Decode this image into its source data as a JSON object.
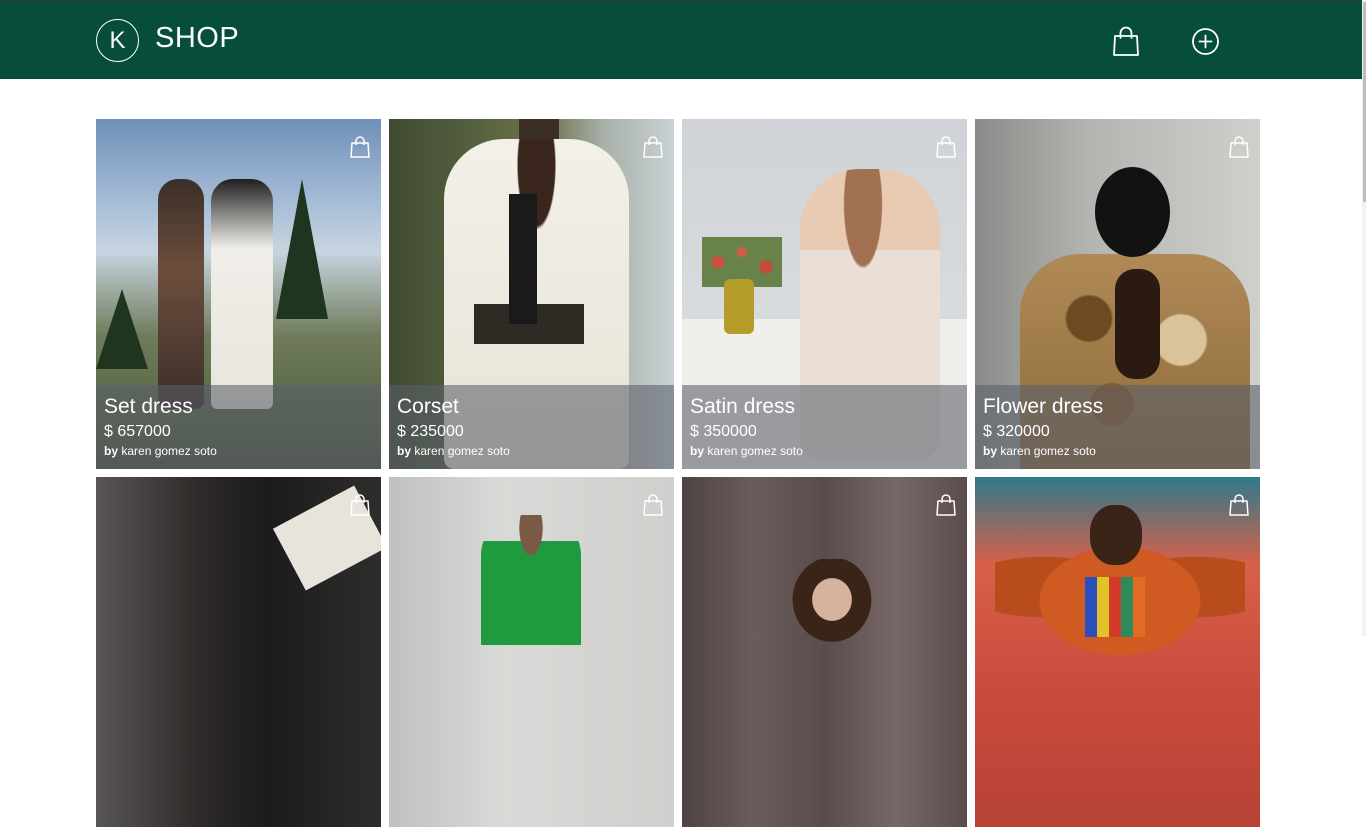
{
  "header": {
    "logo_letter": "K",
    "brand": "SHOP",
    "cart_icon": "shopping-bag-icon",
    "add_icon": "plus-circle-icon",
    "background": "#064d3a"
  },
  "products": [
    {
      "title": "Set dress",
      "price": "$ 657000",
      "by": "by",
      "author": "karen gomez soto"
    },
    {
      "title": "Corset",
      "price": "$ 235000",
      "by": "by",
      "author": "karen gomez soto"
    },
    {
      "title": "Satin dress",
      "price": "$ 350000",
      "by": "by",
      "author": "karen gomez soto"
    },
    {
      "title": "Flower dress",
      "price": "$ 320000",
      "by": "by",
      "author": "karen gomez soto"
    },
    {
      "title": "",
      "price": "",
      "by": "",
      "author": ""
    },
    {
      "title": "",
      "price": "",
      "by": "",
      "author": ""
    },
    {
      "title": "",
      "price": "",
      "by": "",
      "author": ""
    },
    {
      "title": "",
      "price": "",
      "by": "",
      "author": ""
    }
  ]
}
